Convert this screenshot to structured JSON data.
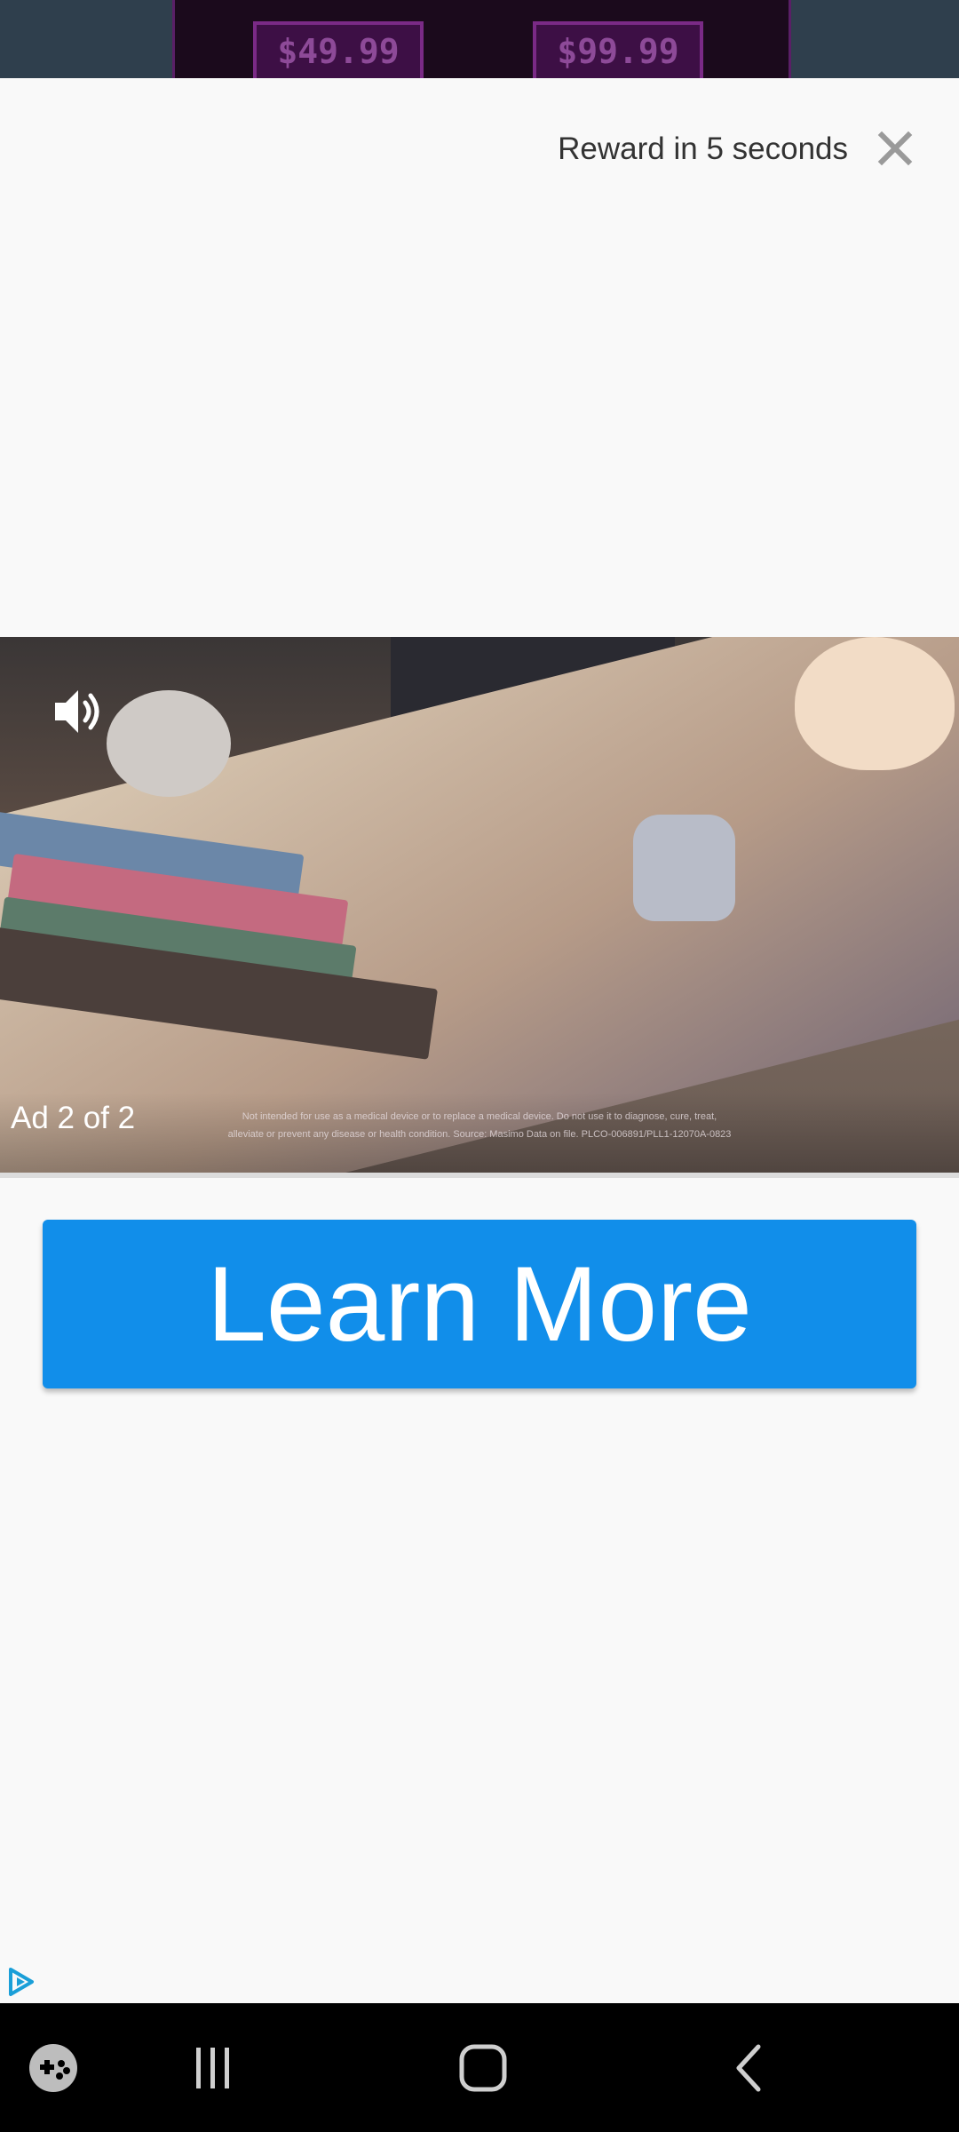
{
  "background_app": {
    "prices": [
      "$49.99",
      "$99.99"
    ]
  },
  "ad": {
    "reward_text": "Reward in 5 seconds",
    "close_icon": "close-icon",
    "speaker_icon": "speaker-icon",
    "ad_counter": "Ad 2 of 2",
    "disclaimer": "Not intended for use as a medical device or to replace a medical device. Do not use it to diagnose, cure, treat, alleviate or prevent any disease or health condition. Source: Masimo Data on file. PLCO-006891/PLL1-12070A-0823",
    "cta_label": "Learn More",
    "adchoices_icon": "adchoices-icon",
    "cta_color": "#118eea"
  },
  "navbar": {
    "icons": [
      "game-launcher-icon",
      "recent-apps-icon",
      "home-icon",
      "back-icon"
    ]
  }
}
